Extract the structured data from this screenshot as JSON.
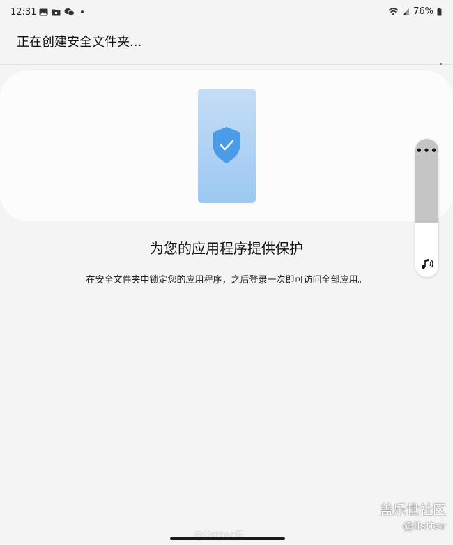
{
  "status_bar": {
    "time": "12:31",
    "battery": "76%",
    "left_icons": [
      "image-icon",
      "folder-icon",
      "wechat-icon"
    ],
    "right_icons": [
      "wifi-icon",
      "signal-icon",
      "battery-icon"
    ]
  },
  "app_bar": {
    "title": "正在创建安全文件夹..."
  },
  "hero": {
    "illustration": "phone-shield-check",
    "accent": "#4a9be8"
  },
  "content": {
    "heading": "为您的应用程序提供保护",
    "description": "在安全文件夹中锁定您的应用程序，之后登录一次即可访问全部应用。"
  },
  "floating_panel": {
    "more": "•••",
    "icon": "music-note-icon"
  },
  "watermarks": {
    "brand": "盖乐世社区",
    "user": "@listter",
    "weibo": "@listter乐"
  }
}
